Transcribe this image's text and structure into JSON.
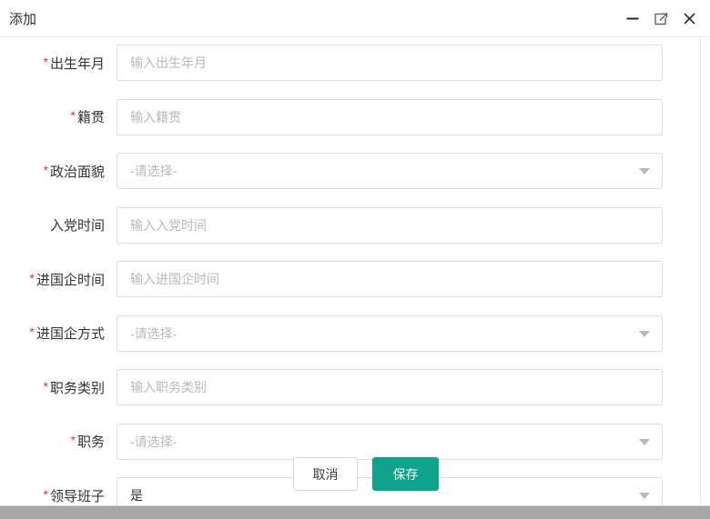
{
  "dialog": {
    "title": "添加",
    "window_controls": {
      "minimize": "minimize",
      "maximize": "maximize",
      "close": "close"
    }
  },
  "form": {
    "required_marker": "*",
    "fields": [
      {
        "label": "出生年月",
        "required": true,
        "type": "input",
        "placeholder": "输入出生年月"
      },
      {
        "label": "籍贯",
        "required": true,
        "type": "input",
        "placeholder": "输入籍贯"
      },
      {
        "label": "政治面貌",
        "required": true,
        "type": "select",
        "placeholder": "-请选择-"
      },
      {
        "label": "入党时间",
        "required": false,
        "type": "input",
        "placeholder": "输入入党时间"
      },
      {
        "label": "进国企时间",
        "required": true,
        "type": "input",
        "placeholder": "输入进国企时间"
      },
      {
        "label": "进国企方式",
        "required": true,
        "type": "select",
        "placeholder": "-请选择-"
      },
      {
        "label": "职务类别",
        "required": true,
        "type": "input",
        "placeholder": "输入职务类别"
      },
      {
        "label": "职务",
        "required": true,
        "type": "select",
        "placeholder": "-请选择-"
      },
      {
        "label": "领导班子",
        "required": true,
        "type": "select",
        "value": "是"
      }
    ]
  },
  "footer": {
    "cancel_label": "取消",
    "save_label": "保存"
  },
  "colors": {
    "accent": "#0fa38e",
    "required": "#e23030",
    "input_border": "#dcdcdc",
    "placeholder": "#b6b9be",
    "scrollbar": "#a6a6a6"
  }
}
